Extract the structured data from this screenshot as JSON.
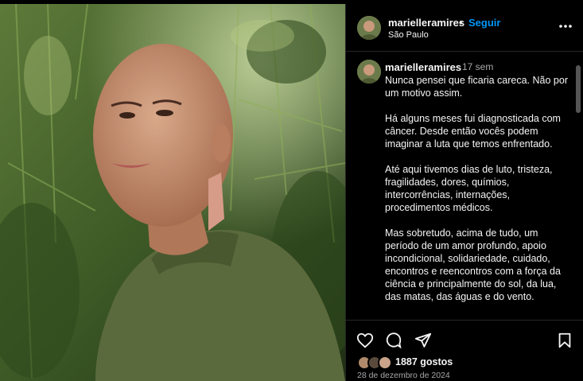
{
  "post": {
    "username": "marielleramires",
    "follow_label": "Seguir",
    "separator": "•",
    "location": "São Paulo",
    "caption_time": "17 sem",
    "caption_paragraphs": [
      "Nunca pensei que ficaria careca. Não por um motivo assim.",
      "Há alguns meses fui diagnosticada com câncer. Desde então vocês podem imaginar a luta que temos enfrentado.",
      "Até aqui tivemos dias de luto, tristeza, fragilidades, dores, químios, intercorrências, internações, procedimentos médicos.",
      "Mas sobretudo, acima de tudo, um período de um amor profundo, apoio incondicional, solidariedade, cuidado, encontros e reencontros com a força da ciência e principalmente do sol, da lua, das matas, das águas e do vento."
    ],
    "likes_label": "1887 gostos",
    "date": "28 de dezembro de 2024"
  },
  "icons": {
    "more": "more-horizontal-icon",
    "like": "heart-icon",
    "comment": "comment-icon",
    "share": "send-icon",
    "save": "bookmark-icon"
  },
  "colors": {
    "background": "#000000",
    "follow": "#0095f6",
    "text": "#f5f5f5",
    "muted": "#a8a8a8",
    "border": "#262626"
  }
}
